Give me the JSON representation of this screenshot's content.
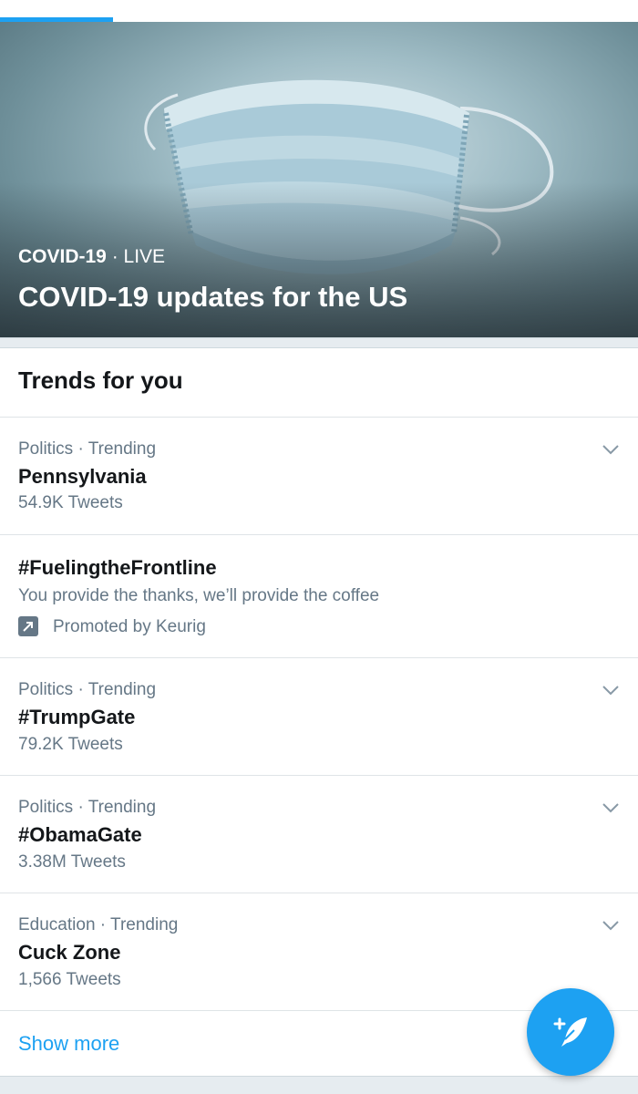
{
  "hero": {
    "category": "COVID-19",
    "separator": " · ",
    "status": "LIVE",
    "title": "COVID-19 updates for the US",
    "image_icon": "face-mask-photo"
  },
  "trends_section": {
    "title": "Trends for you",
    "items": [
      {
        "meta": "Politics · Trending",
        "name": "Pennsylvania",
        "count": "54.9K Tweets",
        "icon": "chevron-down-icon"
      },
      {
        "name": "#FuelingtheFrontline",
        "description": "You provide the thanks, we’ll provide the coffee",
        "promoted": "Promoted by Keurig",
        "icon": "promoted-icon"
      },
      {
        "meta": "Politics · Trending",
        "name": "#TrumpGate",
        "count": "79.2K Tweets",
        "icon": "chevron-down-icon"
      },
      {
        "meta": "Politics · Trending",
        "name": "#ObamaGate",
        "count": "3.38M Tweets",
        "icon": "chevron-down-icon"
      },
      {
        "meta": "Education · Trending",
        "name": "Cuck Zone",
        "count": "1,566 Tweets",
        "icon": "chevron-down-icon"
      }
    ],
    "show_more": "Show more"
  },
  "fab": {
    "icon": "compose-tweet-icon"
  },
  "colors": {
    "accent": "#1da1f2",
    "secondary_text": "#657786",
    "primary_text": "#14171a"
  }
}
